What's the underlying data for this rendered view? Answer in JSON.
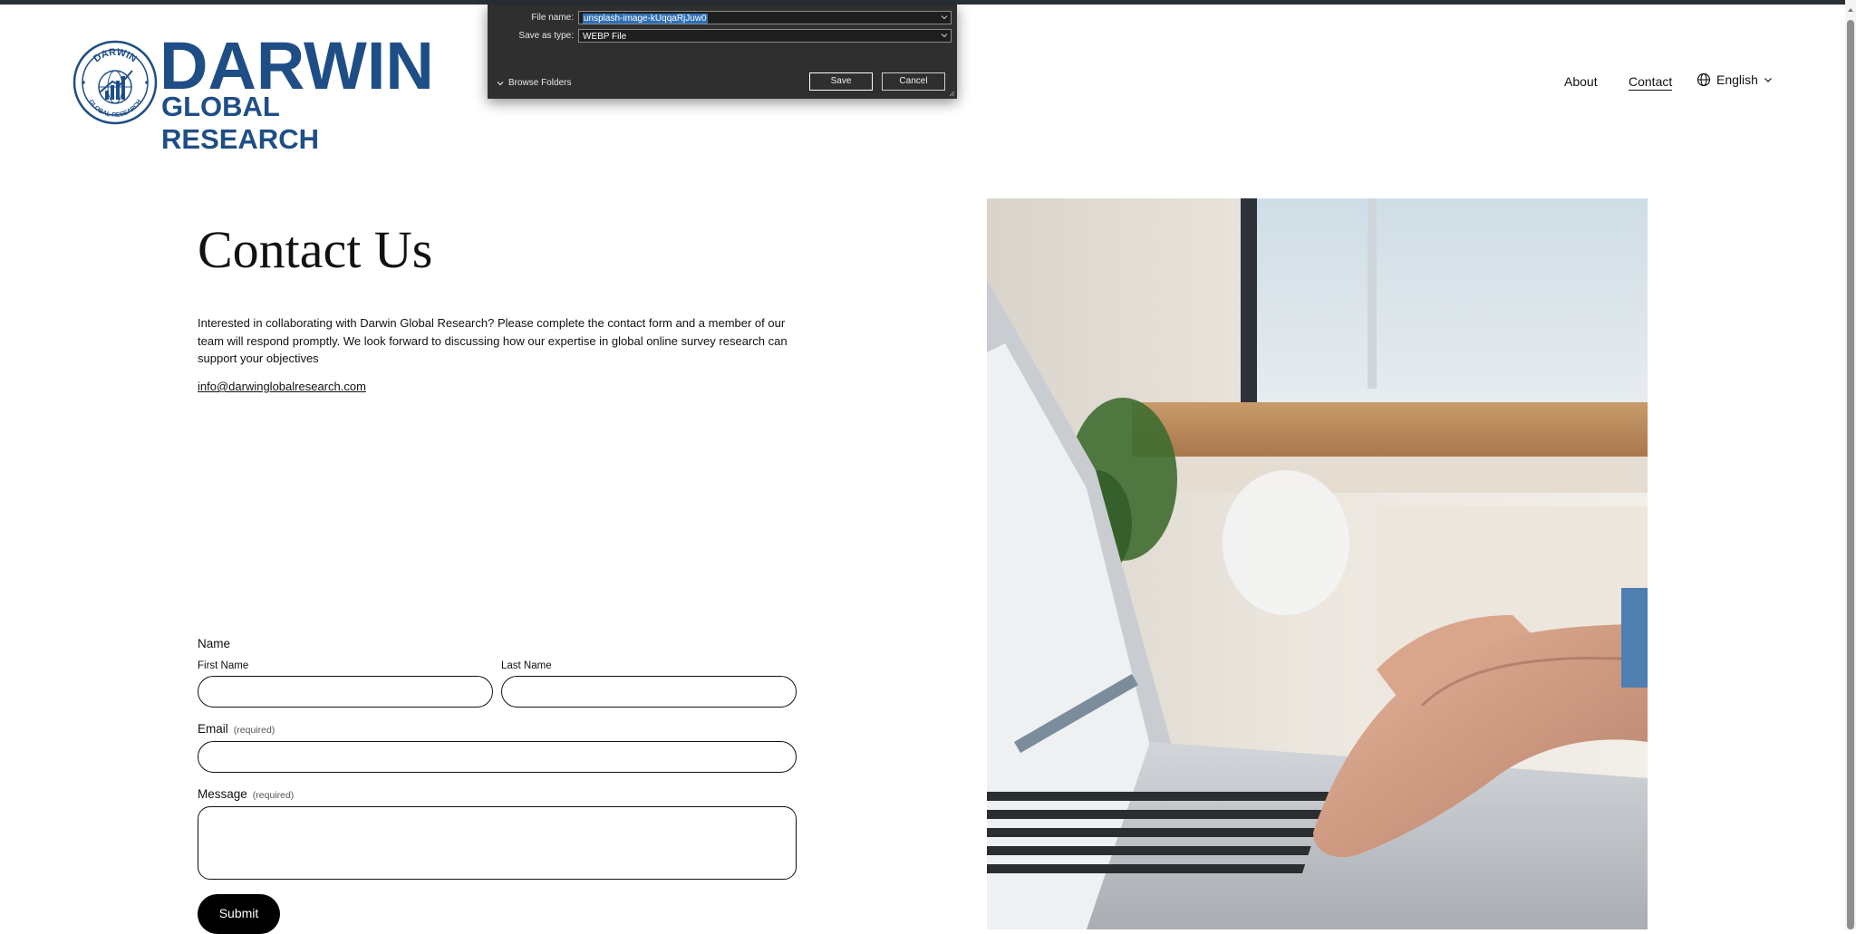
{
  "brand": {
    "title": "DARWIN",
    "subtitle": "GLOBAL RESEARCH",
    "emblem_text_top": "DARWIN",
    "emblem_text_bottom": "GLOBAL RESEARCH",
    "color": "#1f4e86"
  },
  "nav": {
    "items": [
      "About",
      "Contact"
    ],
    "active": "Contact",
    "language": "English"
  },
  "dialog": {
    "file_name_label": "File name:",
    "file_name_value": "unsplash-image-kUqqaRjJuw0",
    "save_type_label": "Save as type:",
    "save_type_value": "WEBP File",
    "browse_folders": "Browse Folders",
    "save_button": "Save",
    "cancel_button": "Cancel"
  },
  "main": {
    "heading": "Contact Us",
    "intro": "Interested in collaborating with Darwin Global Research? Please complete the contact form and a member of our team will respond promptly. We look forward to discussing how our expertise in global online survey research can support your objectives",
    "email": "info@darwinglobalresearch.com"
  },
  "form": {
    "name_label": "Name",
    "first_name_label": "First Name",
    "last_name_label": "Last Name",
    "email_label": "Email",
    "message_label": "Message",
    "required_text": "(required)",
    "submit_label": "Submit"
  },
  "icons": {
    "language": "globe-icon",
    "language_caret": "chevron-down-icon",
    "browse": "chevron-down-icon"
  }
}
